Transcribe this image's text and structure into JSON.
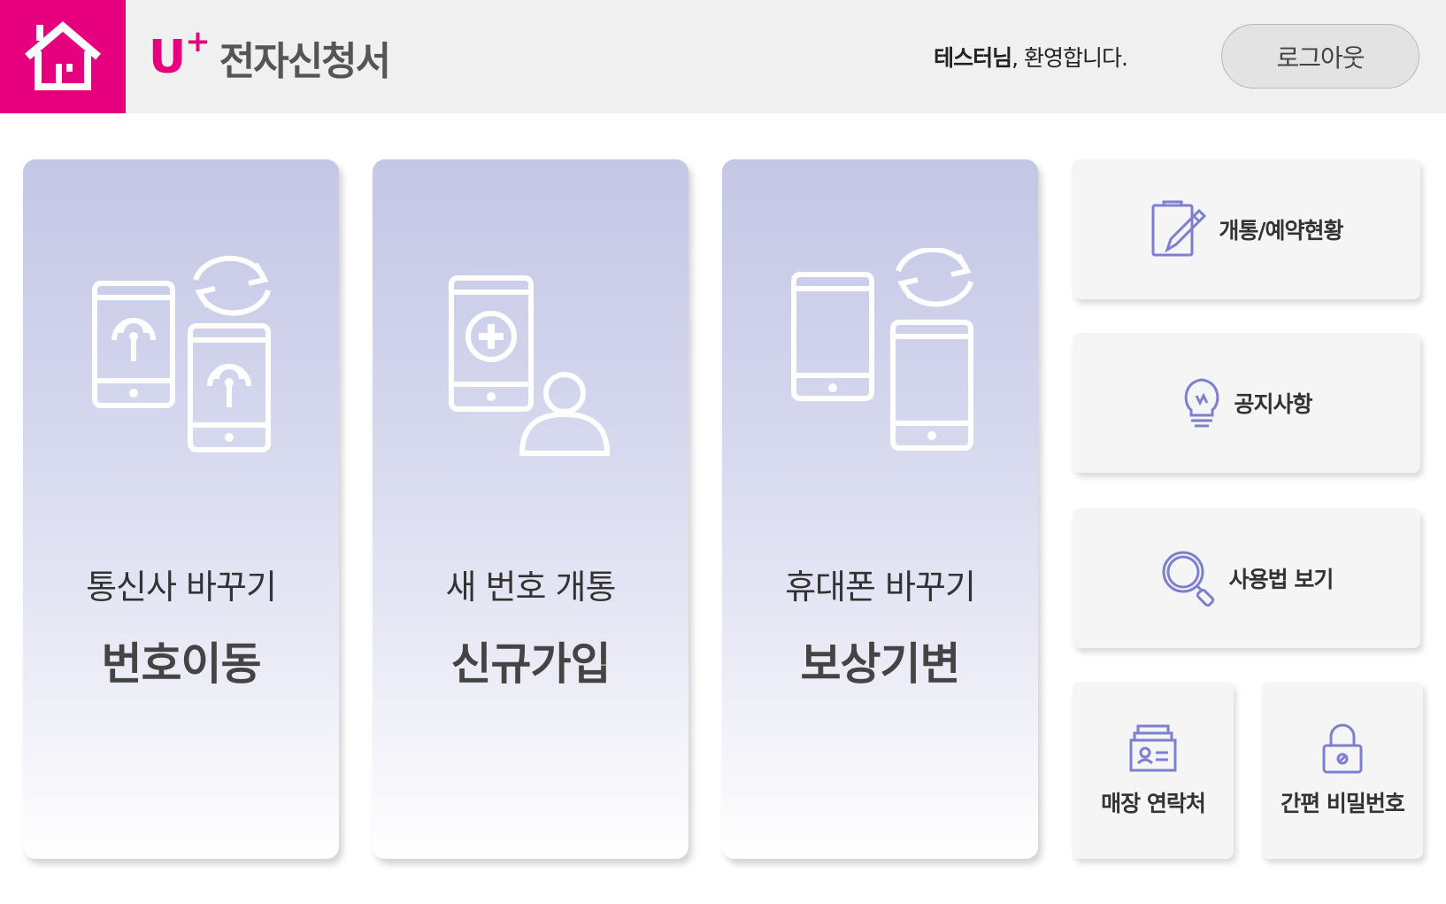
{
  "header": {
    "home_icon": "home-icon",
    "logo_brand": "U",
    "logo_plus": "+",
    "logo_title": "전자신청서",
    "welcome_user": "테스터님",
    "welcome_suffix": ", 환영합니다.",
    "logout_label": "로그아웃"
  },
  "cards": [
    {
      "sub": "통신사 바꾸기",
      "main": "번호이동",
      "icon": "phone-transfer-icon"
    },
    {
      "sub": "새 번호 개통",
      "main": "신규가입",
      "icon": "new-subscription-icon"
    },
    {
      "sub": "휴대폰 바꾸기",
      "main": "보상기변",
      "icon": "phone-exchange-icon"
    }
  ],
  "side": [
    {
      "label": "개통/예약현황",
      "icon": "clipboard-pen-icon"
    },
    {
      "label": "공지사항",
      "icon": "lightbulb-icon"
    },
    {
      "label": "사용법 보기",
      "icon": "magnifier-icon"
    },
    {
      "label": "매장 연락처",
      "icon": "card-file-icon"
    },
    {
      "label": "간편 비밀번호",
      "icon": "lock-icon"
    }
  ],
  "colors": {
    "brand": "#e6007e",
    "accent_icon": "#7d7fd0"
  }
}
